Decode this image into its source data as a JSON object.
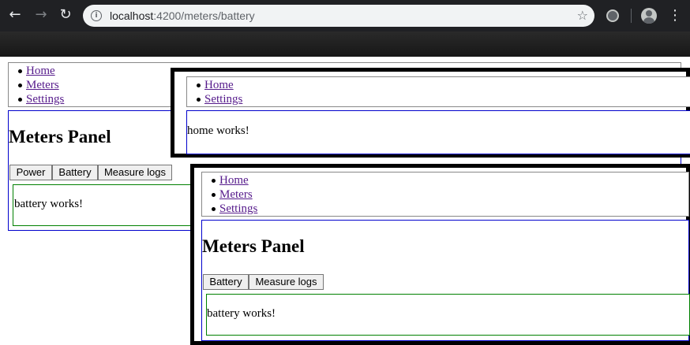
{
  "browser": {
    "url_host": "localhost",
    "url_rest": ":4200/meters/battery",
    "icons": {
      "back": "back-arrow-icon",
      "forward": "forward-arrow-icon",
      "reload": "reload-icon",
      "info": "info-icon",
      "bookmark": "star-icon",
      "extension": "extension-icon",
      "profile": "avatar-icon",
      "menu": "kebab-menu-icon"
    }
  },
  "main_view": {
    "nav": [
      "Home",
      "Meters",
      "Settings"
    ],
    "title": "Meters Panel",
    "buttons": [
      "Power",
      "Battery",
      "Measure logs"
    ],
    "body_text": "battery works!"
  },
  "overlay_home": {
    "nav": [
      "Home",
      "Settings"
    ],
    "body_text": "home works!"
  },
  "overlay_meters": {
    "nav": [
      "Home",
      "Meters",
      "Settings"
    ],
    "title": "Meters Panel",
    "buttons": [
      "Battery",
      "Measure logs"
    ],
    "body_text": "battery works!"
  },
  "colors": {
    "chrome_bg": "#202124",
    "omnibox_bg": "#f1f3f4",
    "link": "#551a8b",
    "panel_border": "#0000cc",
    "content_border": "#008000"
  }
}
